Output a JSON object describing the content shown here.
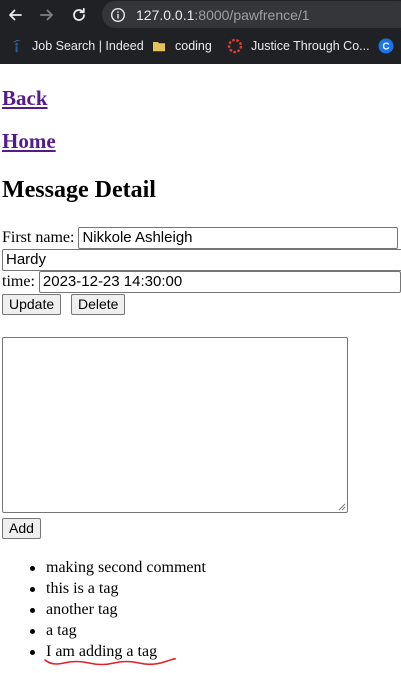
{
  "browser": {
    "url_host": "127.0.0.1",
    "url_rest": ":8000/pawfrence/1",
    "bookmarks": [
      {
        "label": "Job Search | Indeed",
        "icon": "indeed-icon"
      },
      {
        "label": "coding",
        "icon": "folder-icon"
      },
      {
        "label": "Justice Through Co...",
        "icon": "justice-icon"
      },
      {
        "label": "",
        "icon": "c-icon"
      }
    ]
  },
  "page": {
    "back_link": "Back",
    "home_link": "Home",
    "title": "Message Detail",
    "first_name_label": "First name:",
    "first_name_value": "Nikkole Ashleigh",
    "last_name_value": "Hardy",
    "time_label": "time:",
    "time_value": "2023-12-23 14:30:00",
    "update_button": "Update",
    "delete_button": "Delete",
    "comment_value": "",
    "add_button": "Add",
    "tags": [
      "making second comment",
      "this is a tag",
      "another tag",
      "a tag",
      "I am adding a tag"
    ]
  },
  "colors": {
    "chrome_bg": "#202124",
    "link_visited": "#551a8b",
    "spellcheck_underline": "#e0202a"
  }
}
